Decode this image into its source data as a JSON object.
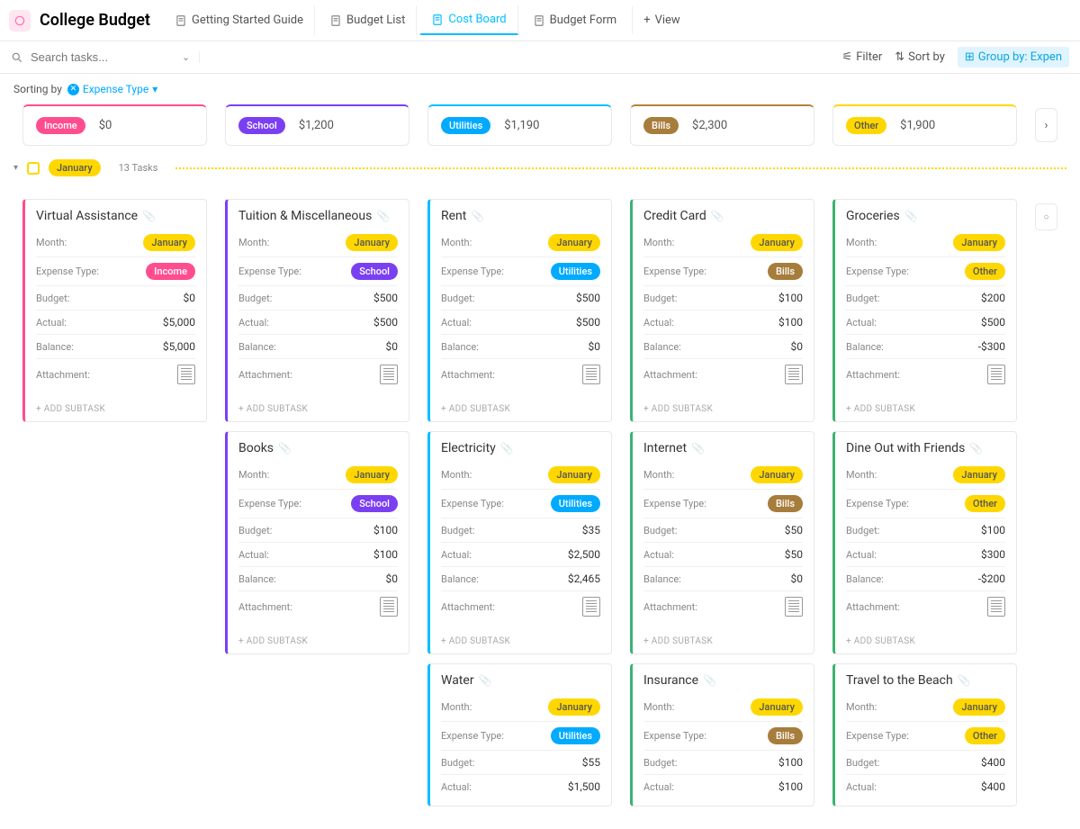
{
  "header": {
    "title": "College Budget",
    "tabs": [
      {
        "label": "Getting Started Guide"
      },
      {
        "label": "Budget List"
      },
      {
        "label": "Cost Board",
        "active": true
      },
      {
        "label": "Budget Form"
      }
    ],
    "add_view": "View"
  },
  "toolbar": {
    "search_placeholder": "Search tasks...",
    "filter": "Filter",
    "sort": "Sort by",
    "group": "Group by: Expen"
  },
  "sorting": {
    "label": "Sorting by",
    "field": "Expense Type"
  },
  "categories": [
    {
      "name": "Income",
      "class": "income",
      "value": "$0"
    },
    {
      "name": "School",
      "class": "school",
      "value": "$1,200"
    },
    {
      "name": "Utilities",
      "class": "utilities",
      "value": "$1,190"
    },
    {
      "name": "Bills",
      "class": "bills",
      "value": "$2,300"
    },
    {
      "name": "Other",
      "class": "other",
      "value": "$1,900"
    }
  ],
  "month": {
    "name": "January",
    "task_count": "13 Tasks"
  },
  "labels": {
    "month": "Month:",
    "type": "Expense Type:",
    "budget": "Budget:",
    "actual": "Actual:",
    "balance": "Balance:",
    "attachment": "Attachment:",
    "add_subtask": "+ ADD SUBTASK"
  },
  "columns": [
    {
      "card_class": "card-income",
      "pill_class": "pill-income",
      "cards": [
        {
          "title": "Virtual Assistance",
          "month": "January",
          "type": "Income",
          "budget": "$0",
          "actual": "$5,000",
          "balance": "$5,000",
          "attachment": true
        }
      ]
    },
    {
      "card_class": "card-school",
      "pill_class": "pill-school",
      "cards": [
        {
          "title": "Tuition & Miscellaneous",
          "month": "January",
          "type": "School",
          "budget": "$500",
          "actual": "$500",
          "balance": "$0",
          "attachment": true
        },
        {
          "title": "Books",
          "month": "January",
          "type": "School",
          "budget": "$100",
          "actual": "$100",
          "balance": "$0",
          "attachment": true
        }
      ]
    },
    {
      "card_class": "card-utilities",
      "pill_class": "pill-utilities",
      "cards": [
        {
          "title": "Rent",
          "month": "January",
          "type": "Utilities",
          "budget": "$500",
          "actual": "$500",
          "balance": "$0",
          "attachment": true
        },
        {
          "title": "Electricity",
          "month": "January",
          "type": "Utilities",
          "budget": "$35",
          "actual": "$2,500",
          "balance": "$2,465",
          "attachment": true
        },
        {
          "title": "Water",
          "month": "January",
          "type": "Utilities",
          "budget": "$55",
          "actual": "$1,500"
        }
      ]
    },
    {
      "card_class": "card-bills",
      "pill_class": "pill-bills",
      "cards": [
        {
          "title": "Credit Card",
          "month": "January",
          "type": "Bills",
          "budget": "$100",
          "actual": "$100",
          "balance": "$0",
          "attachment": true
        },
        {
          "title": "Internet",
          "month": "January",
          "type": "Bills",
          "budget": "$50",
          "actual": "$50",
          "balance": "$0",
          "attachment": true
        },
        {
          "title": "Insurance",
          "month": "January",
          "type": "Bills",
          "budget": "$100",
          "actual": "$100"
        }
      ]
    },
    {
      "card_class": "card-other",
      "pill_class": "pill-other",
      "cards": [
        {
          "title": "Groceries",
          "month": "January",
          "type": "Other",
          "budget": "$200",
          "actual": "$500",
          "balance": "-$300",
          "attachment": true
        },
        {
          "title": "Dine Out with Friends",
          "month": "January",
          "type": "Other",
          "budget": "$100",
          "actual": "$300",
          "balance": "-$200",
          "attachment": true
        },
        {
          "title": "Travel to the Beach",
          "month": "January",
          "type": "Other",
          "budget": "$400",
          "actual": "$400"
        }
      ]
    }
  ]
}
